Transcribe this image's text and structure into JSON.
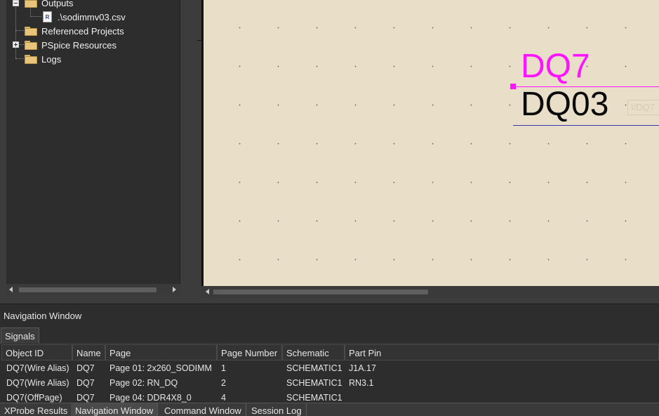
{
  "project_tree": {
    "items": [
      {
        "label": "Outputs",
        "icon": "folder-icon",
        "expander": "minus"
      },
      {
        "label": ".\\sodimmv03.csv",
        "icon": "report-file-icon",
        "icon_glyph": "R"
      },
      {
        "label": "Referenced Projects",
        "icon": "folder-icon"
      },
      {
        "label": "PSpice Resources",
        "icon": "folder-icon",
        "expander": "plus"
      },
      {
        "label": "Logs",
        "icon": "folder-icon"
      }
    ]
  },
  "canvas": {
    "background": "#e9dfc8",
    "net_alias": "DQ7",
    "net_alias_color": "#ff14ff",
    "net_name": "DQ03",
    "net_name_color": "#0a0a0a",
    "ghost_ref": "I/DQ7"
  },
  "navigation": {
    "title": "Navigation Window",
    "signals_tab": "Signals",
    "columns": [
      "Object ID",
      "Name",
      "Page",
      "Page Number",
      "Schematic",
      "Part Pin"
    ],
    "rows": [
      [
        "DQ7(Wire Alias)",
        "DQ7",
        "Page 01: 2x260_SODIMM",
        "1",
        "SCHEMATIC1",
        "J1A.17"
      ],
      [
        "DQ7(Wire Alias)",
        "DQ7",
        "Page 02:  RN_DQ",
        "2",
        "SCHEMATIC1",
        "RN3.1"
      ],
      [
        "DQ7(OffPage)",
        "DQ7",
        "Page 04: DDR4X8_0",
        "4",
        "SCHEMATIC1",
        ""
      ]
    ]
  },
  "bottom_tabs": {
    "items": [
      "XProbe Results",
      "Navigation Window",
      "Command Window",
      "Session Log"
    ],
    "active": "Navigation Window"
  }
}
